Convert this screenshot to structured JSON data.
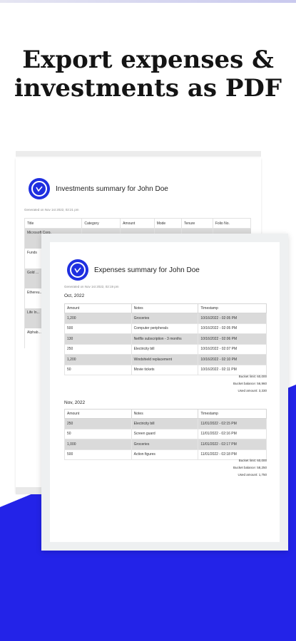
{
  "headline": {
    "line1": "Export expenses &",
    "line2": "investments as PDF"
  },
  "colors": {
    "accent": "#2323e8",
    "logo": "#1f2fe0",
    "row_shade": "#d9d9d9"
  },
  "investments_doc": {
    "title": "Investments summary for John Doe",
    "generated": "Generated on Nov 1st 2022, 02:21 pm",
    "columns": [
      "Title",
      "Category",
      "Amount",
      "Mode",
      "Tenure",
      "Folio No."
    ],
    "rows": [
      "Microsoft Corp.",
      "Funds",
      "Gold ...",
      "Ethereu...",
      "Life In...",
      "Alphab..."
    ]
  },
  "expenses_doc": {
    "title": "Expenses summary for John Doe",
    "generated": "Generated on Nov 1st 2022, 02:19 pm",
    "columns": [
      "Amount",
      "Notes",
      "Timestamp"
    ],
    "months": [
      {
        "label": "Oct, 2022",
        "rows": [
          {
            "amount": "1,200",
            "notes": "Groceries",
            "timestamp": "10/16/2022 - 02:05 PM"
          },
          {
            "amount": "500",
            "notes": "Computer peripherals",
            "timestamp": "10/16/2022 - 02:05 PM"
          },
          {
            "amount": "130",
            "notes": "Netflix subscription - 3 months",
            "timestamp": "10/16/2022 - 02:06 PM"
          },
          {
            "amount": "250",
            "notes": "Electricity bill",
            "timestamp": "10/16/2022 - 02:07 PM"
          },
          {
            "amount": "1,200",
            "notes": "Windshield replacement",
            "timestamp": "10/16/2022 - 02:10 PM"
          },
          {
            "amount": "50",
            "notes": "Movie tickets",
            "timestamp": "10/16/2022 - 02:11 PM"
          }
        ],
        "bucket_limit": "Bucket limit: 60,000",
        "bucket_balance": "Bucket balance: 56,960",
        "used_amount": "Used amount: 3,330"
      },
      {
        "label": "Nov, 2022",
        "rows": [
          {
            "amount": "250",
            "notes": "Electricity bill",
            "timestamp": "11/01/2022 - 02:15 PM"
          },
          {
            "amount": "50",
            "notes": "Screen guard",
            "timestamp": "11/01/2022 - 02:16 PM"
          },
          {
            "amount": "1,000",
            "notes": "Groceries",
            "timestamp": "11/01/2022 - 02:17 PM"
          },
          {
            "amount": "500",
            "notes": "Action figures",
            "timestamp": "11/01/2022 - 02:18 PM"
          }
        ],
        "bucket_limit": "Bucket limit: 60,000",
        "bucket_balance": "Bucket balance: 58,250",
        "used_amount": "Used amount: 1,750"
      }
    ]
  }
}
